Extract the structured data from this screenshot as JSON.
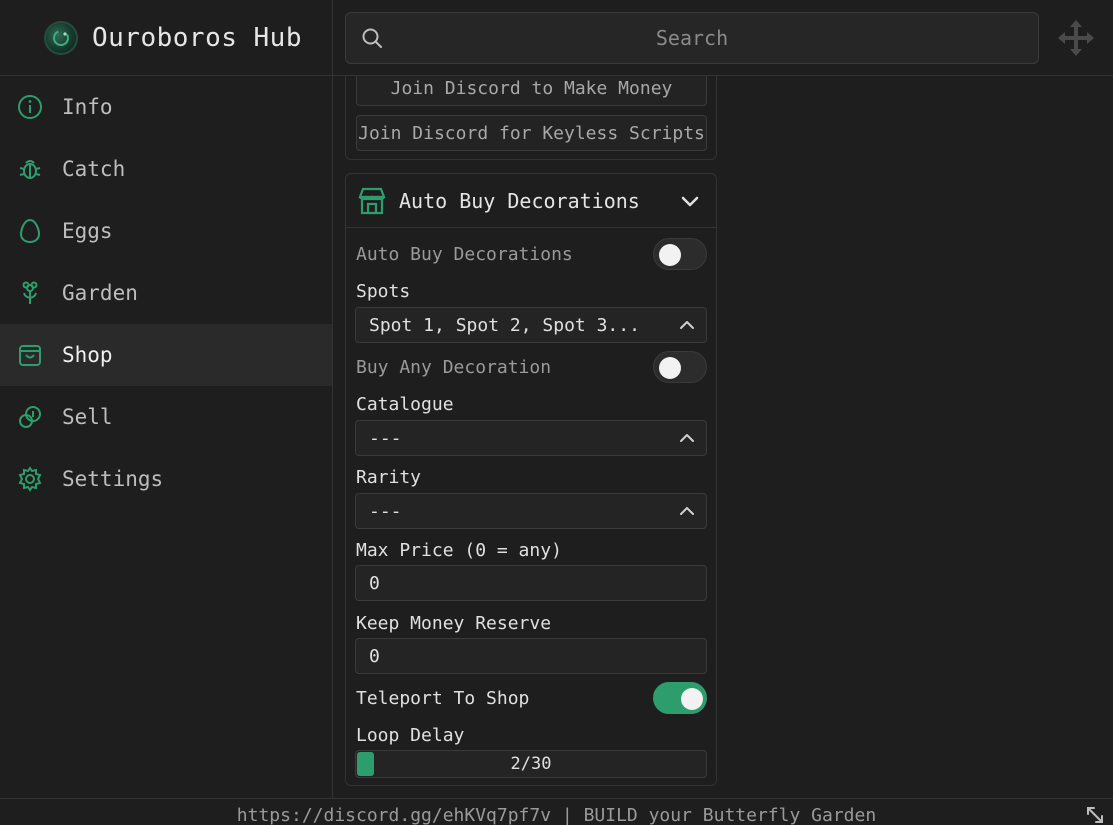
{
  "app": {
    "title": "Ouroboros Hub"
  },
  "search": {
    "placeholder": "Search"
  },
  "sidebar": {
    "items": [
      {
        "label": "Info",
        "icon": "info-icon"
      },
      {
        "label": "Catch",
        "icon": "bug-icon"
      },
      {
        "label": "Eggs",
        "icon": "egg-icon"
      },
      {
        "label": "Garden",
        "icon": "flower-icon"
      },
      {
        "label": "Shop",
        "icon": "shopping-bag-icon",
        "active": true
      },
      {
        "label": "Sell",
        "icon": "coins-icon"
      },
      {
        "label": "Settings",
        "icon": "gear-icon"
      }
    ]
  },
  "links": {
    "money": "Join Discord to Make Money",
    "keyless": "Join Discord for Keyless Scripts"
  },
  "section": {
    "title": "Auto Buy Decorations",
    "icon": "store-icon",
    "auto_buy": {
      "label": "Auto Buy Decorations",
      "on": false
    },
    "spots": {
      "label": "Spots",
      "value": "Spot 1, Spot 2, Spot 3..."
    },
    "buy_any": {
      "label": "Buy Any Decoration",
      "on": false
    },
    "catalogue": {
      "label": "Catalogue",
      "value": "---"
    },
    "rarity": {
      "label": "Rarity",
      "value": "---"
    },
    "max_price": {
      "label": "Max Price (0 = any)",
      "value": "0"
    },
    "reserve": {
      "label": "Keep Money Reserve",
      "value": "0"
    },
    "teleport": {
      "label": "Teleport To Shop",
      "on": true
    },
    "loop_delay": {
      "label": "Loop Delay",
      "value": 2,
      "max": 30,
      "text": "2/30"
    }
  },
  "footer": {
    "text": "https://discord.gg/ehKVq7pf7v | BUILD your Butterfly Garden"
  },
  "colors": {
    "accent": "#2e9d6e",
    "background": "#1e1e1e",
    "border": "#333333"
  }
}
